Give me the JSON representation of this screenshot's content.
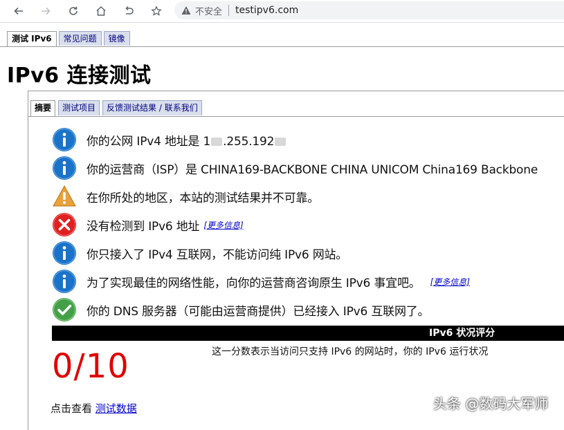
{
  "browser": {
    "security_label": "不安全",
    "url": "testipv6.com",
    "icons": [
      "back-icon",
      "forward-icon",
      "reload-icon",
      "home-icon",
      "undo-icon",
      "bookmark-star-icon",
      "warning-icon"
    ]
  },
  "site_tabs": [
    {
      "label": "测试 IPv6",
      "active": true
    },
    {
      "label": "常见问题",
      "active": false
    },
    {
      "label": "镜像",
      "active": false
    }
  ],
  "page_title": "IPv6 连接测试",
  "inner_tabs": [
    {
      "label": "摘要",
      "active": true
    },
    {
      "label": "测试项目",
      "active": false
    },
    {
      "label": "反馈测试结果 / 联系我们",
      "active": false
    }
  ],
  "results": [
    {
      "icon": "info-icon",
      "prefix": "你的公网 IPv4 地址是 1",
      "mid": ".255.192",
      "suffix": ""
    },
    {
      "icon": "info-icon",
      "text": "你的运营商（ISP）是 CHINA169-BACKBONE CHINA UNICOM China169 Backbone"
    },
    {
      "icon": "warning-triangle-icon",
      "text": "在你所处的地区，本站的测试结果并不可靠。"
    },
    {
      "icon": "error-x-icon",
      "text": "没有检测到 IPv6 地址",
      "more": "[更多信息]"
    },
    {
      "icon": "info-icon",
      "text": "你只接入了 IPv4 互联网，不能访问纯 IPv6 网站。"
    },
    {
      "icon": "info-icon",
      "text": "为了实现最佳的网络性能，向你的运营商咨询原生 IPv6 事宜吧。",
      "more": "[更多信息]"
    },
    {
      "icon": "success-check-icon",
      "text": "你的 DNS 服务器（可能由运营商提供）已经接入 IPv6 互联网了。"
    }
  ],
  "score": {
    "heading": "IPv6 状况评分",
    "value": "0/10",
    "description": "这一分数表示当访问只支持 IPv6 的网站时，你的 IPv6 运行状况"
  },
  "footer": {
    "prefix": "点击查看",
    "link": "测试数据"
  },
  "watermark": "头条 @数码大军师",
  "colors": {
    "info": "#1a73c8",
    "warning": "#e8a23a",
    "error": "#e02020",
    "success": "#43a047",
    "score": "#e00000",
    "link": "#0000cc"
  }
}
